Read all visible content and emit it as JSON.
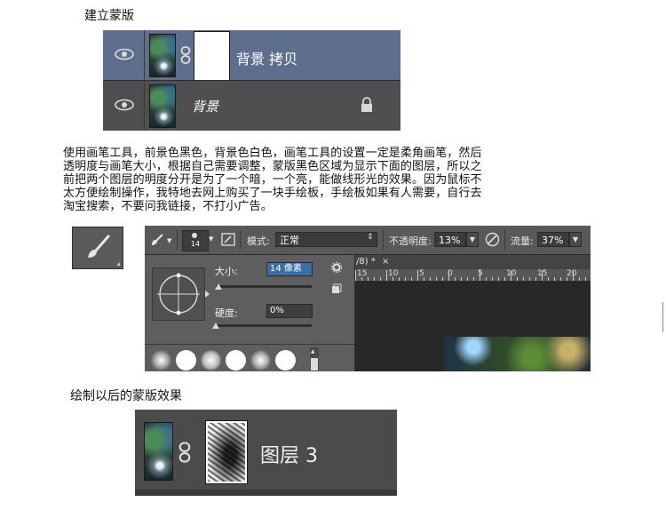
{
  "headings": {
    "create_mask": "建立蒙版",
    "result": "绘制以后的蒙版效果"
  },
  "layers_panel_top": {
    "layer1_name": "背景 拷贝",
    "layer2_name": "背景"
  },
  "paragraph": [
    "使用画笔工具，前景色黑色，背景色白色，画笔工具的设置一定是柔角画笔，然后",
    "透明度与画笔大小，根据自己需要调整，蒙版黑色区域为显示下面的图层，所以之",
    "前把两个图层的明度分开是为了一个暗，一个亮，能做线形光的效果。因为鼠标不",
    "太方便绘制操作，我特地去网上购买了一块手绘板，手绘板如果有人需要，自行去",
    "淘宝搜索，不要问我链接，不打小广告。"
  ],
  "options_bar": {
    "brush_size_value": "14",
    "mode_label": "模式:",
    "mode_value": "正常",
    "opacity_label": "不透明度:",
    "opacity_value": "13%",
    "flow_label": "流量:",
    "flow_value": "37%"
  },
  "brush_picker": {
    "size_label": "大小:",
    "size_value": "14 像素",
    "hardness_label": "硬度:",
    "hardness_value": "0%",
    "size_slider_fraction": 0.03,
    "hardness_slider_fraction": 0.0
  },
  "document": {
    "tab_text": "/8) *",
    "ruler_labels": [
      "15",
      "10",
      "5",
      "0",
      "5",
      "10",
      "15",
      "20"
    ]
  },
  "layers_panel_bottom": {
    "layer_name": "图层 3"
  },
  "colors": {
    "panel_bg": "#535353",
    "selected_row": "#5d6f8c",
    "text_light": "#ffffff"
  }
}
